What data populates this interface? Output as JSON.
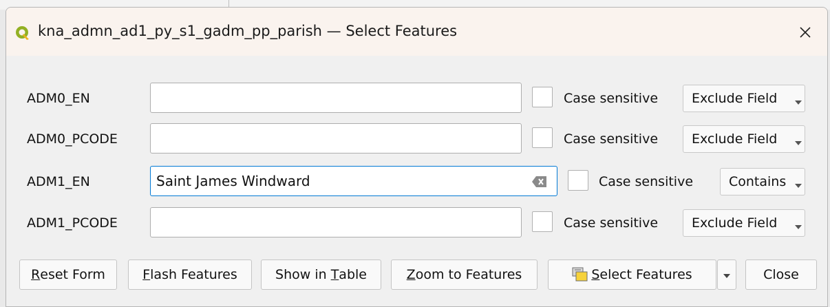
{
  "window": {
    "title": "kna_admn_ad1_py_s1_gadm_pp_parish — Select Features",
    "icon": "qgis-logo-icon",
    "close_icon": "close-icon"
  },
  "fields": [
    {
      "label": "ADM0_EN",
      "value": "",
      "case_sensitive_label": "Case sensitive",
      "case_sensitive": false,
      "operator": "Exclude Field"
    },
    {
      "label": "ADM0_PCODE",
      "value": "",
      "case_sensitive_label": "Case sensitive",
      "case_sensitive": false,
      "operator": "Exclude Field"
    },
    {
      "label": "ADM1_EN",
      "value": "Saint James Windward",
      "case_sensitive_label": "Case sensitive",
      "case_sensitive": false,
      "operator": "Contains"
    },
    {
      "label": "ADM1_PCODE",
      "value": "",
      "case_sensitive_label": "Case sensitive",
      "case_sensitive": false,
      "operator": "Exclude Field"
    }
  ],
  "buttons": {
    "reset": {
      "mnemonic": "R",
      "rest": "eset Form"
    },
    "flash": {
      "mnemonic": "F",
      "rest": "lash Features"
    },
    "show_table": {
      "pre": "Show in ",
      "mnemonic": "T",
      "rest": "able"
    },
    "zoom": {
      "mnemonic": "Z",
      "rest": "oom to Features"
    },
    "select": {
      "mnemonic": "S",
      "rest": "elect Features"
    },
    "close": "Close"
  },
  "colors": {
    "accent": "#0078d4",
    "titlebar": "#faf3ee",
    "dialog_bg": "#f0f0f0"
  }
}
